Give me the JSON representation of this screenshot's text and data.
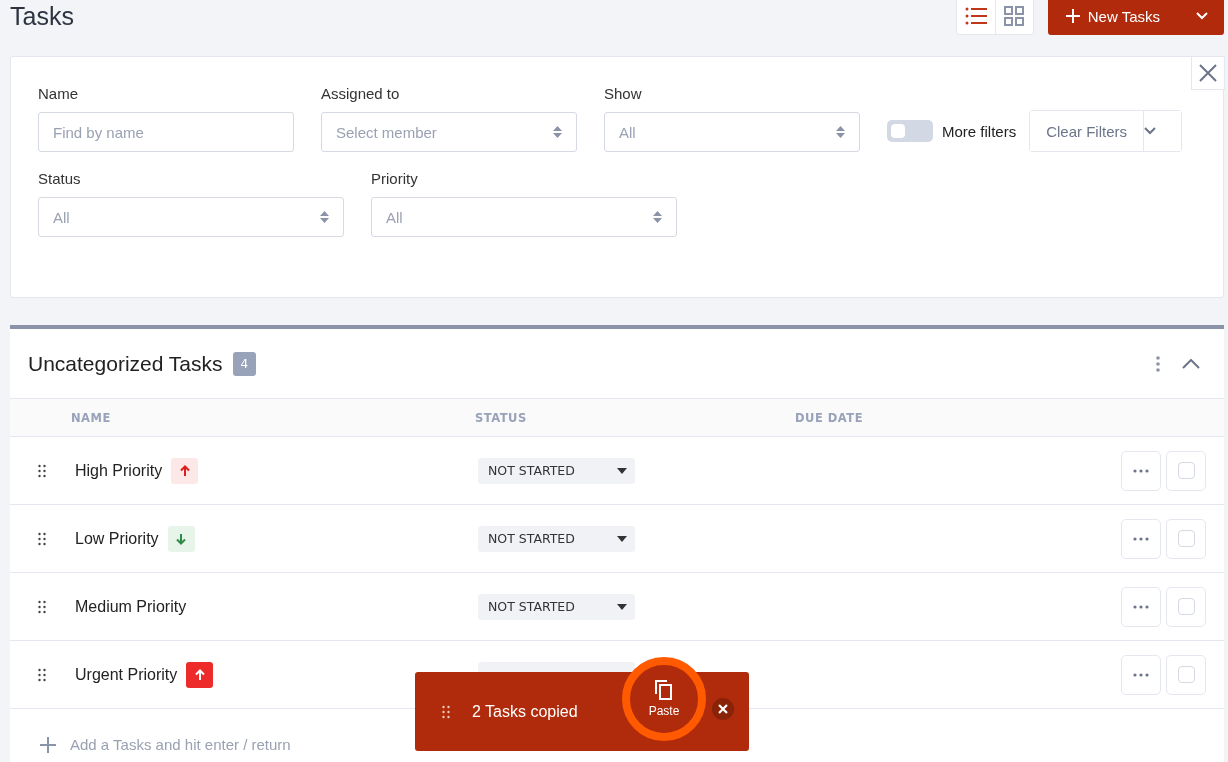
{
  "page": {
    "title": "Tasks"
  },
  "view_toggle": [
    {
      "kind": "list",
      "selected": true
    },
    {
      "kind": "grid",
      "selected": false
    }
  ],
  "new_button": {
    "label": "New Tasks"
  },
  "filters": {
    "name": {
      "label": "Name",
      "placeholder": "Find by name"
    },
    "assigned": {
      "label": "Assigned to",
      "placeholder": "Select member"
    },
    "show": {
      "label": "Show",
      "value": "All"
    },
    "more_filters": {
      "label": "More filters",
      "on": false
    },
    "clear": {
      "label": "Clear Filters"
    },
    "status": {
      "label": "Status",
      "value": "All"
    },
    "priority": {
      "label": "Priority",
      "value": "All"
    }
  },
  "section": {
    "title": "Uncategorized Tasks",
    "count": "4",
    "expanded": true,
    "columns": [
      "NAME",
      "STATUS",
      "DUE DATE"
    ],
    "rows": [
      {
        "name": "High Priority",
        "kind": "high",
        "status": "NOT STARTED",
        "checked": false
      },
      {
        "name": "Low Priority",
        "kind": "low",
        "status": "NOT STARTED",
        "checked": false
      },
      {
        "name": "Medium Priority",
        "kind": "medium",
        "status": "NOT STARTED",
        "checked": false
      },
      {
        "name": "Urgent Priority",
        "kind": "urgent",
        "checked": false
      }
    ],
    "add_placeholder": "Add a Tasks and hit enter / return"
  },
  "toast": {
    "message": "2 Tasks copied",
    "action": "Paste"
  }
}
